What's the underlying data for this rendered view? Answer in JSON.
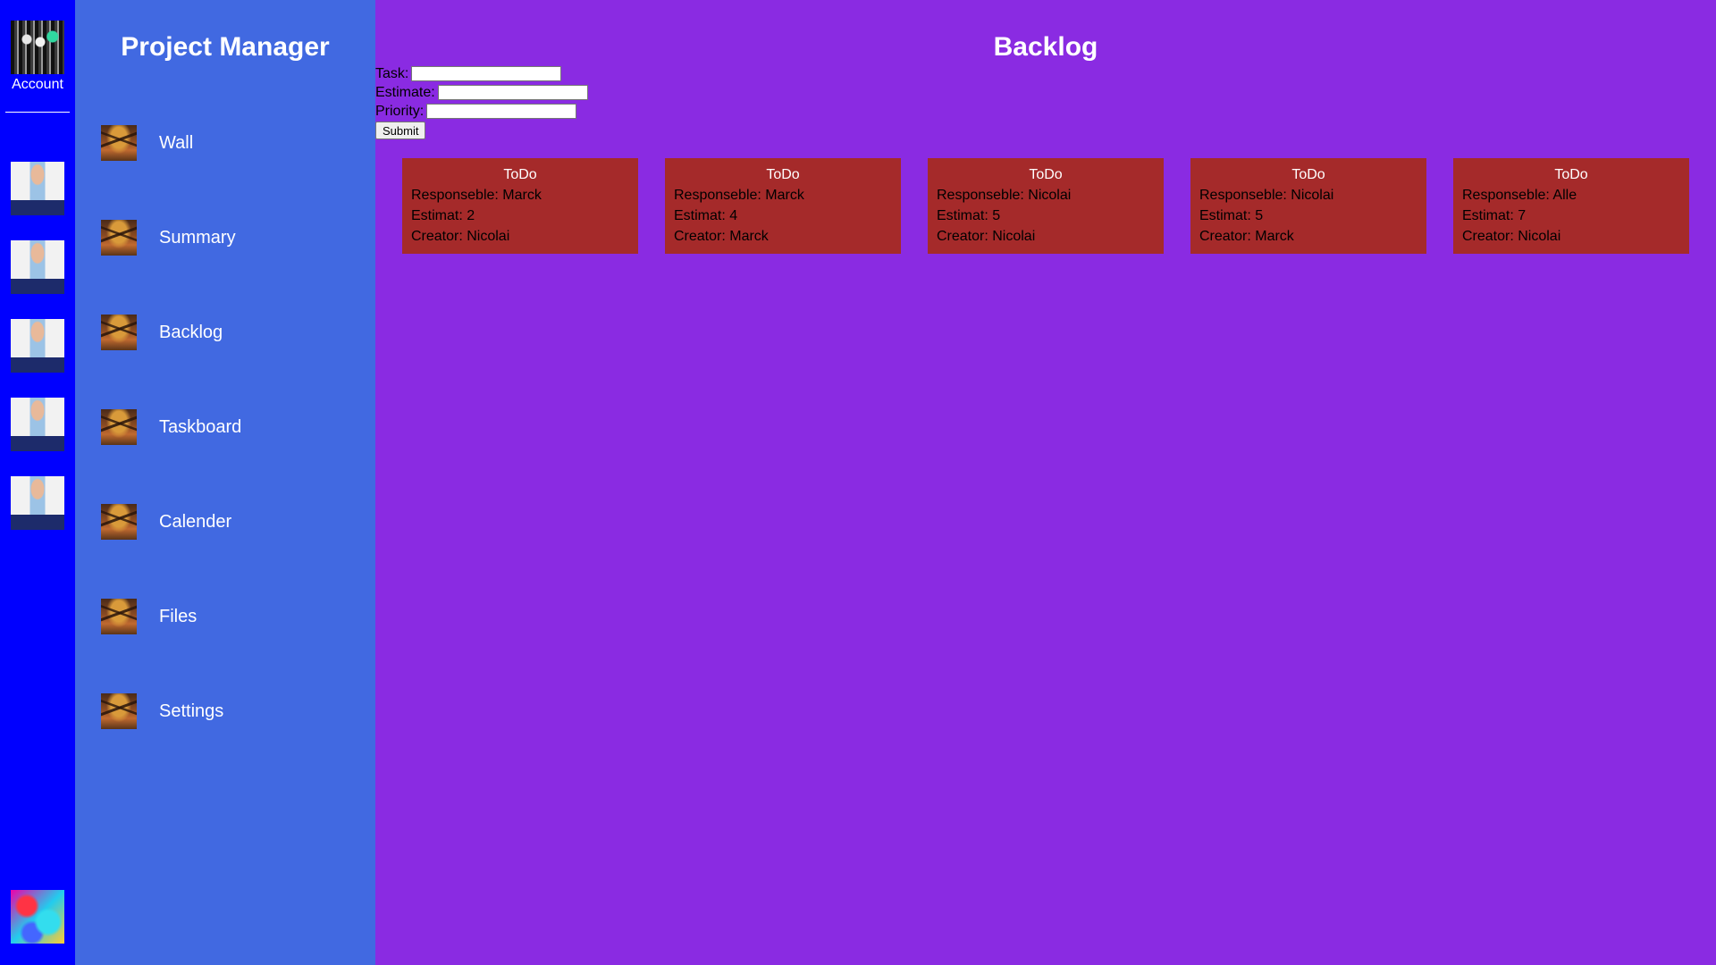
{
  "account": {
    "label": "Account"
  },
  "team_members": [
    {
      "avatar": "person-avatar"
    },
    {
      "avatar": "person-avatar"
    },
    {
      "avatar": "person-avatar"
    },
    {
      "avatar": "person-avatar"
    },
    {
      "avatar": "person-avatar"
    }
  ],
  "sidebar": {
    "title": "Project Manager",
    "items": [
      {
        "label": "Wall",
        "icon": "autumn-tree-icon"
      },
      {
        "label": "Summary",
        "icon": "autumn-tree-icon"
      },
      {
        "label": "Backlog",
        "icon": "autumn-tree-icon"
      },
      {
        "label": "Taskboard",
        "icon": "autumn-tree-icon"
      },
      {
        "label": "Calender",
        "icon": "autumn-tree-icon"
      },
      {
        "label": "Files",
        "icon": "autumn-tree-icon"
      },
      {
        "label": "Settings",
        "icon": "autumn-tree-icon"
      }
    ]
  },
  "main": {
    "title": "Backlog",
    "form": {
      "task_label": "Task:",
      "task_value": "",
      "estimate_label": "Estimate:",
      "estimate_value": "",
      "priority_label": "Priority:",
      "priority_value": "",
      "submit_label": "Submit"
    },
    "cards": [
      {
        "status": "ToDo",
        "responsible": "Responseble: Marck",
        "estimate": "Estimat: 2",
        "creator": "Creator: Nicolai"
      },
      {
        "status": "ToDo",
        "responsible": "Responseble: Marck",
        "estimate": "Estimat: 4",
        "creator": "Creator: Marck"
      },
      {
        "status": "ToDo",
        "responsible": "Responseble: Nicolai",
        "estimate": "Estimat: 5",
        "creator": "Creator: Nicolai"
      },
      {
        "status": "ToDo",
        "responsible": "Responseble: Nicolai",
        "estimate": "Estimat: 5",
        "creator": "Creator: Marck"
      },
      {
        "status": "ToDo",
        "responsible": "Responseble: Alle",
        "estimate": "Estimat: 7",
        "creator": "Creator: Nicolai"
      }
    ]
  },
  "colors": {
    "rail": "#0000ff",
    "sidebar": "#4169e1",
    "main": "#8a2be2",
    "card": "#a52a2a"
  }
}
